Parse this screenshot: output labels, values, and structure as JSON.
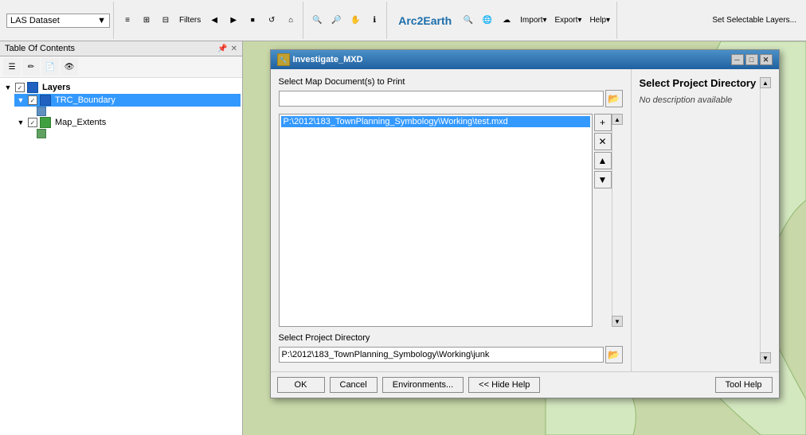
{
  "toolbar": {
    "dataset_label": "LAS Dataset",
    "filters_label": "Filters",
    "arc2earth_label": "Arc2Earth",
    "import_label": "Import▾",
    "export_label": "Export▾",
    "help_label": "Help▾",
    "set_selectable_label": "Set Selectable Layers..."
  },
  "toc": {
    "title": "Table Of Contents",
    "layers_label": "Layers",
    "layer1_name": "TRC_Boundary",
    "layer2_name": "Map_Extents"
  },
  "dialog": {
    "title": "Investigate_MXD",
    "select_map_label": "Select Map Document(s) to Print",
    "mxd_path": "P:\\2012\\183_TownPlanning_Symbology\\Working\\test.mxd",
    "select_project_label": "Select Project Directory",
    "project_path": "P:\\2012\\183_TownPlanning_Symbology\\Working\\junk",
    "right_panel_title": "Select Project Directory",
    "right_panel_desc": "No description available",
    "ok_label": "OK",
    "cancel_label": "Cancel",
    "environments_label": "Environments...",
    "hide_help_label": "<< Hide Help",
    "tool_help_label": "Tool Help"
  }
}
